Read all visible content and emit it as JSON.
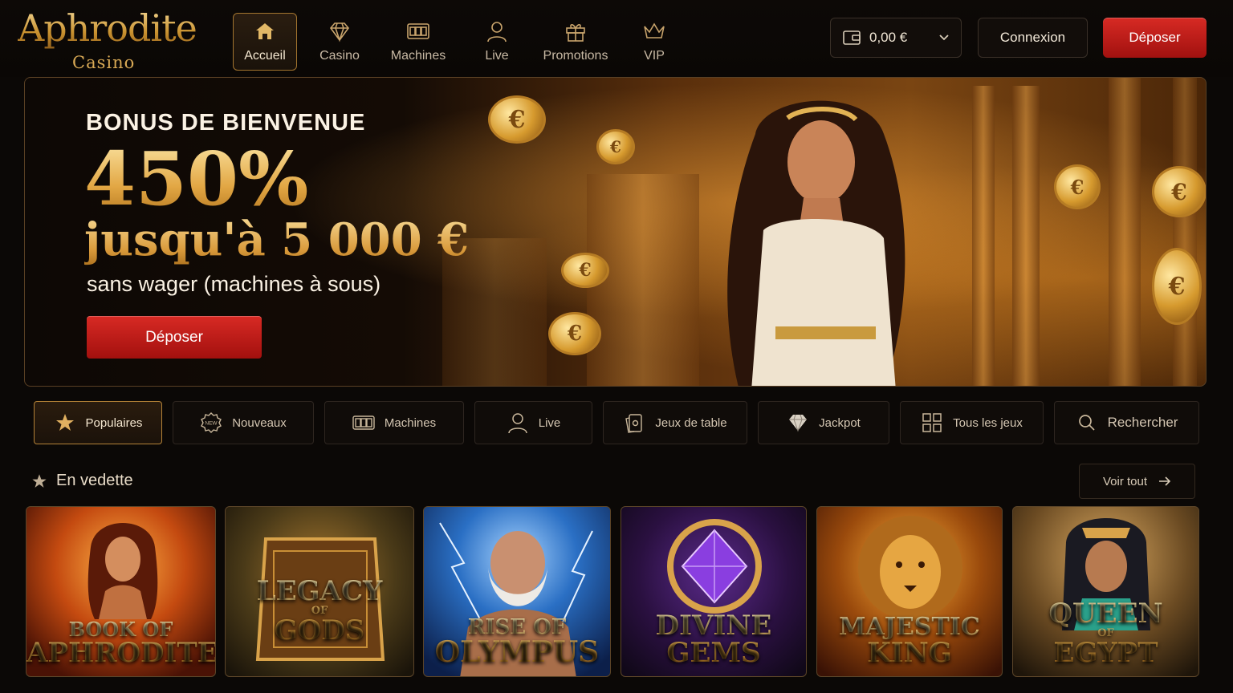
{
  "brand": {
    "name": "Aphrodite",
    "sub": "Casino"
  },
  "nav": [
    {
      "label": "Accueil",
      "icon": "home-icon"
    },
    {
      "label": "Casino",
      "icon": "diamond-icon"
    },
    {
      "label": "Machines",
      "icon": "slot-machine-icon"
    },
    {
      "label": "Live",
      "icon": "user-icon"
    },
    {
      "label": "Promotions",
      "icon": "gift-icon"
    },
    {
      "label": "VIP",
      "icon": "crown-icon"
    }
  ],
  "header": {
    "balance": "0,00 €",
    "login_label": "Connexion",
    "deposit_label": "Déposer"
  },
  "hero": {
    "subtitle": "BONUS DE BIENVENUE",
    "percent": "450%",
    "upto": "jusqu'à 5 000 €",
    "note": "sans wager (machines à sous)",
    "cta": "Déposer",
    "coin_symbol": "€"
  },
  "categories": [
    {
      "label": "Populaires",
      "icon": "star-icon"
    },
    {
      "label": "Nouveaux",
      "icon": "new-badge-icon"
    },
    {
      "label": "Machines",
      "icon": "slot-machine-icon"
    },
    {
      "label": "Live",
      "icon": "user-icon"
    },
    {
      "label": "Jeux de table",
      "icon": "cards-icon"
    },
    {
      "label": "Jackpot",
      "icon": "diamond-icon"
    },
    {
      "label": "Tous les jeux",
      "icon": "grid-icon"
    },
    {
      "label": "Rechercher",
      "icon": "search-icon"
    }
  ],
  "featured": {
    "title": "En vedette",
    "see_all": "Voir tout",
    "games": [
      {
        "line1": "BOOK OF",
        "line2": "APHRODITE"
      },
      {
        "line1": "LEGACY",
        "mid": "OF",
        "line2": "GODS"
      },
      {
        "line1": "RISE OF",
        "line2": "OLYMPUS"
      },
      {
        "line1": "DIVINE",
        "line2": "GEMS"
      },
      {
        "line1": "MAJESTIC",
        "line2": "KING"
      },
      {
        "line1": "QUEEN",
        "mid": "OF",
        "line2": "EGYPT"
      }
    ]
  },
  "colors": {
    "accent_gold": "#d9a24a",
    "cta_red": "#c91d1a",
    "background": "#0b0806"
  }
}
